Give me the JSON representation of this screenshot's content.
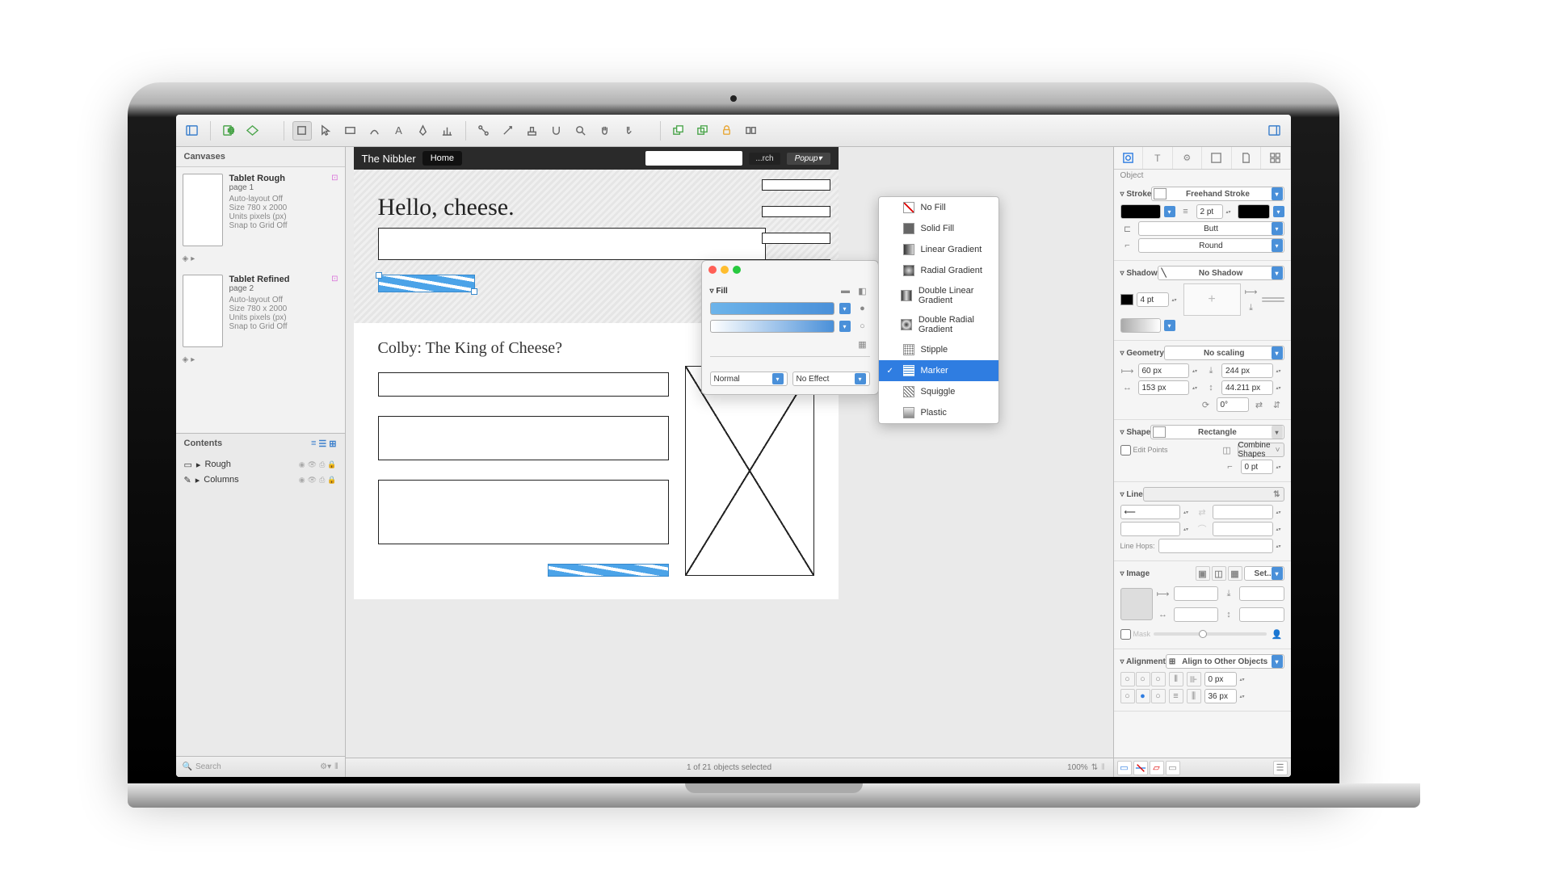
{
  "sidebar": {
    "canvases_header": "Canvases",
    "contents_header": "Contents",
    "canvases": [
      {
        "title": "Tablet Rough",
        "page": "page 1",
        "autolayout": "Auto-layout Off",
        "size": "Size 780 x 2000",
        "units": "Units pixels (px)",
        "snap": "Snap to Grid Off"
      },
      {
        "title": "Tablet Refined",
        "page": "page 2",
        "autolayout": "Auto-layout Off",
        "size": "Size 780 x 2000",
        "units": "Units pixels (px)",
        "snap": "Snap to Grid Off"
      }
    ],
    "contents": [
      {
        "icon": "▭",
        "label": "Rough"
      },
      {
        "icon": "✎",
        "label": "Columns"
      }
    ],
    "search_placeholder": "Search"
  },
  "wireframe": {
    "site_title": "The Nibbler",
    "nav_home": "Home",
    "nav_search": "...rch",
    "nav_popup": "Popup▾",
    "hero_title": "Hello, cheese.",
    "article_title": "Colby: The King of Cheese?"
  },
  "fill_popover": {
    "title": "Fill",
    "blend_mode": "Normal",
    "effect": "No Effect",
    "menu": [
      "No Fill",
      "Solid Fill",
      "Linear Gradient",
      "Radial Gradient",
      "Double Linear Gradient",
      "Double Radial Gradient",
      "Stipple",
      "Marker",
      "Squiggle",
      "Plastic"
    ],
    "selected": "Marker"
  },
  "status": {
    "selection": "1 of 21 objects selected",
    "zoom": "100%"
  },
  "inspector": {
    "label": "Object",
    "stroke": {
      "title": "Stroke",
      "type": "Freehand Stroke",
      "width": "2 pt",
      "cap": "Butt",
      "join": "Round"
    },
    "shadow": {
      "title": "Shadow",
      "type": "No Shadow",
      "size": "4 pt"
    },
    "geometry": {
      "title": "Geometry",
      "scaling": "No scaling",
      "x": "60 px",
      "y": "244 px",
      "w": "153 px",
      "h": "44.211 px",
      "rot": "0°"
    },
    "shape": {
      "title": "Shape",
      "type": "Rectangle",
      "edit_points": "Edit Points",
      "combine": "Combine Shapes",
      "radius": "0 pt"
    },
    "line": {
      "title": "Line",
      "hops": "Line Hops:"
    },
    "image": {
      "title": "Image",
      "set": "Set...",
      "mask": "Mask"
    },
    "alignment": {
      "title": "Alignment",
      "mode": "Align to Other Objects",
      "v1": "0 px",
      "v2": "36 px"
    }
  }
}
